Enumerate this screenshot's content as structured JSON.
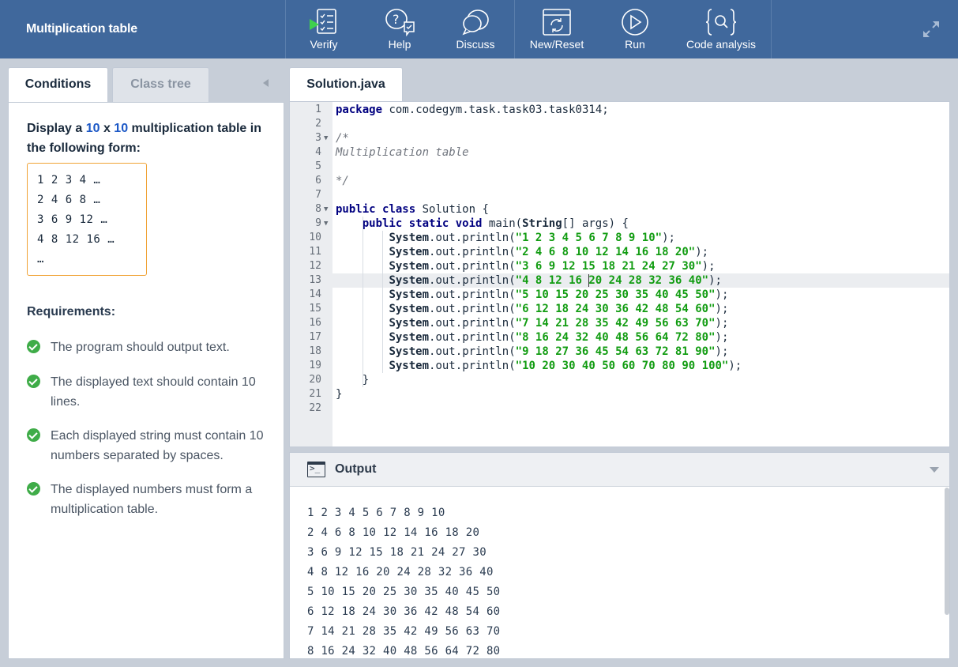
{
  "app": {
    "title": "Multiplication table"
  },
  "toolbar": {
    "verify": "Verify",
    "help": "Help",
    "discuss": "Discuss",
    "new_reset": "New/Reset",
    "run": "Run",
    "code_analysis": "Code analysis"
  },
  "left": {
    "tabs": [
      "Conditions",
      "Class tree"
    ],
    "task": {
      "prefix": "Display a ",
      "n1": "10",
      "x": " x ",
      "n2": "10",
      "suffix": " multiplication table in the following form:"
    },
    "example": [
      "1 2 3 4 …",
      "2 4 6 8 …",
      "3 6 9 12 …",
      "4 8 12 16 …",
      "…"
    ],
    "requirements_title": "Requirements:",
    "requirements": [
      "The program should output text.",
      "The displayed text should contain 10 lines.",
      "Each displayed string must contain 10 numbers separated by spaces.",
      "The displayed numbers must form a multiplication table."
    ]
  },
  "editor": {
    "file_tab": "Solution.java",
    "lines": [
      "package com.codegym.task.task03.task0314;",
      "",
      "/*",
      "Multiplication table",
      "",
      "*/",
      "",
      "public class Solution {",
      "    public static void main(String[] args) {",
      "        System.out.println(\"1 2 3 4 5 6 7 8 9 10\");",
      "        System.out.println(\"2 4 6 8 10 12 14 16 18 20\");",
      "        System.out.println(\"3 6 9 12 15 18 21 24 27 30\");",
      "        System.out.println(\"4 8 12 16 20 24 28 32 36 40\");",
      "        System.out.println(\"5 10 15 20 25 30 35 40 45 50\");",
      "        System.out.println(\"6 12 18 24 30 36 42 48 54 60\");",
      "        System.out.println(\"7 14 21 28 35 42 49 56 63 70\");",
      "        System.out.println(\"8 16 24 32 40 48 56 64 72 80\");",
      "        System.out.println(\"9 18 27 36 45 54 63 72 81 90\");",
      "        System.out.println(\"10 20 30 40 50 60 70 80 90 100\");",
      "    }",
      "}",
      ""
    ],
    "active_line": 13
  },
  "output": {
    "title": "Output",
    "lines": [
      "1 2 3 4 5 6 7 8 9 10",
      "2 4 6 8 10 12 14 16 18 20",
      "3 6 9 12 15 18 21 24 27 30",
      "4 8 12 16 20 24 28 32 36 40",
      "5 10 15 20 25 30 35 40 45 50",
      "6 12 18 24 30 36 42 48 54 60",
      "7 14 21 28 35 42 49 56 63 70",
      "8 16 24 32 40 48 56 64 72 80"
    ]
  },
  "colors": {
    "toolbar_bg": "#40689c",
    "keyword": "#000080",
    "string": "#119c11",
    "check": "#3fac48",
    "accent_number": "#1c58c6"
  }
}
